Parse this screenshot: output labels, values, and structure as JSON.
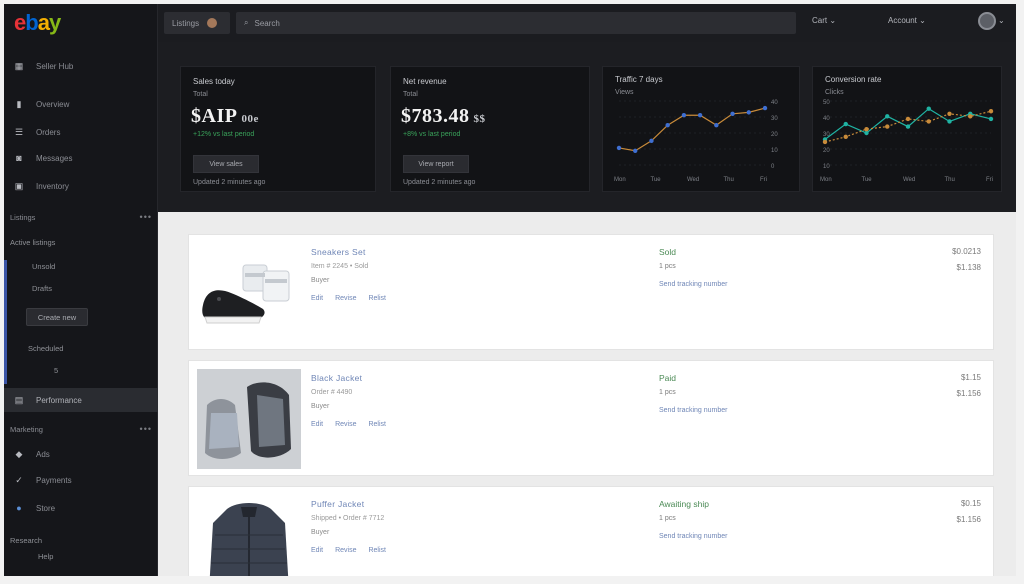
{
  "brand": {
    "logo_letters": [
      "e",
      "b",
      "a",
      "y"
    ],
    "colors": [
      "#e53238",
      "#0064d2",
      "#f5af02",
      "#86b817"
    ]
  },
  "sidebar": {
    "items": [
      {
        "icon": "grid-icon",
        "label": "Seller Hub"
      },
      {
        "icon": "bars-icon",
        "label": "Overview"
      },
      {
        "icon": "list-icon",
        "label": "Orders"
      },
      {
        "icon": "chat-icon",
        "label": "Messages"
      },
      {
        "icon": "box-icon",
        "label": "Inventory"
      }
    ],
    "section1": {
      "label": "Listings",
      "more": "•••"
    },
    "group": "Active listings",
    "sub_items": [
      "Unsold",
      "Drafts"
    ],
    "button": "Create new",
    "sub_more": "Scheduled",
    "count": "5",
    "active_item": "Performance",
    "section2": {
      "label": "Marketing",
      "more": "•••"
    },
    "bottom_items": [
      {
        "icon": "tag-icon",
        "label": "Ads"
      },
      {
        "icon": "check-icon",
        "label": "Payments"
      },
      {
        "icon": "store-icon",
        "label": "Store"
      }
    ],
    "footer_label": "Research",
    "footer_value": "Help"
  },
  "topbar": {
    "filter_label": "Listings",
    "search_placeholder": "Search",
    "account_label": "Cart",
    "user_label": "Account"
  },
  "stats": [
    {
      "title": "Sales today",
      "sub": "Total",
      "value": "$AIP",
      "value_suffix": "00e",
      "delta": "+12% vs last period",
      "button": "View sales",
      "footer": "Updated 2 minutes ago"
    },
    {
      "title": "Net revenue",
      "sub": "Total",
      "value": "$783.48",
      "value_suffix": "$$",
      "delta": "+8% vs last period",
      "button": "View report",
      "footer": "Updated 2 minutes ago"
    }
  ],
  "charts": [
    {
      "title": "Traffic 7 days",
      "sub": "Views",
      "x_labels": [
        "Mon",
        "Tue",
        "Wed",
        "Thu",
        "Fri"
      ],
      "y_labels": [
        "40",
        "30",
        "20",
        "10",
        "0"
      ]
    },
    {
      "title": "Conversion rate",
      "sub": "Clicks",
      "x_labels": [
        "Mon",
        "Tue",
        "Wed",
        "Thu",
        "Fri"
      ],
      "y_labels": [
        "50",
        "40",
        "30",
        "20",
        "10"
      ]
    }
  ],
  "chart_data": [
    {
      "type": "line",
      "title": "Traffic 7 days",
      "x": [
        "1",
        "2",
        "3",
        "4",
        "5",
        "6",
        "7",
        "8",
        "9",
        "10"
      ],
      "series": [
        {
          "values": [
            12,
            10,
            17,
            28,
            35,
            35,
            28,
            36,
            37,
            40
          ]
        }
      ],
      "ylim": [
        0,
        45
      ]
    },
    {
      "type": "line",
      "title": "Conversion rate",
      "x": [
        "1",
        "2",
        "3",
        "4",
        "5",
        "6",
        "7",
        "8",
        "9"
      ],
      "series": [
        {
          "values": [
            20,
            32,
            25,
            38,
            30,
            44,
            34,
            40,
            36
          ]
        },
        {
          "values": [
            18,
            22,
            28,
            30,
            36,
            34,
            40,
            38,
            42
          ]
        }
      ],
      "ylim": [
        0,
        50
      ]
    }
  ],
  "listings": [
    {
      "title": "Sneakers Set",
      "line1": "Item # 2245 • Sold",
      "line2": "Buyer",
      "links": [
        "Edit",
        "Revise",
        "Relist"
      ],
      "status": "Sold",
      "qty": "1 pcs",
      "link": "Send tracking number",
      "price": "$0.0213",
      "price2": "$1.138"
    },
    {
      "title": "Black Jacket",
      "line1": "Order # 4490",
      "line2": "Buyer",
      "links": [
        "Edit",
        "Revise",
        "Relist"
      ],
      "status": "Paid",
      "qty": "1 pcs",
      "link": "Send tracking number",
      "price": "$1.15",
      "price2": "$1.156"
    },
    {
      "title": "Puffer Jacket",
      "line1": "Shipped • Order # 7712",
      "line2": "Buyer",
      "links": [
        "Edit",
        "Revise",
        "Relist"
      ],
      "status": "Awaiting ship",
      "qty": "1 pcs",
      "link": "Send tracking number",
      "price": "$0.15",
      "price2": "$1.156"
    }
  ]
}
